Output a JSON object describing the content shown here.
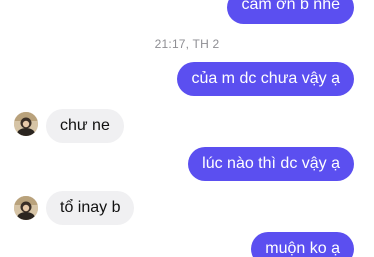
{
  "thread": {
    "timestamp": "21:17, TH 2",
    "messages": [
      {
        "direction": "outgoing",
        "text": "cảm ơn b nhé"
      },
      {
        "direction": "outgoing",
        "text": "của m dc chưa vậy ạ"
      },
      {
        "direction": "incoming",
        "text": "chư ne"
      },
      {
        "direction": "outgoing",
        "text": "lúc nào thì dc vậy ạ"
      },
      {
        "direction": "incoming",
        "text": "tổ inay b"
      },
      {
        "direction": "outgoing",
        "text": "muộn ko ạ"
      }
    ]
  },
  "colors": {
    "outgoing_bubble": "#5b4ff0",
    "incoming_bubble": "#f0f0f2",
    "timestamp_text": "#8e8e93"
  },
  "icons": {
    "contact_avatar": "contact-avatar"
  }
}
